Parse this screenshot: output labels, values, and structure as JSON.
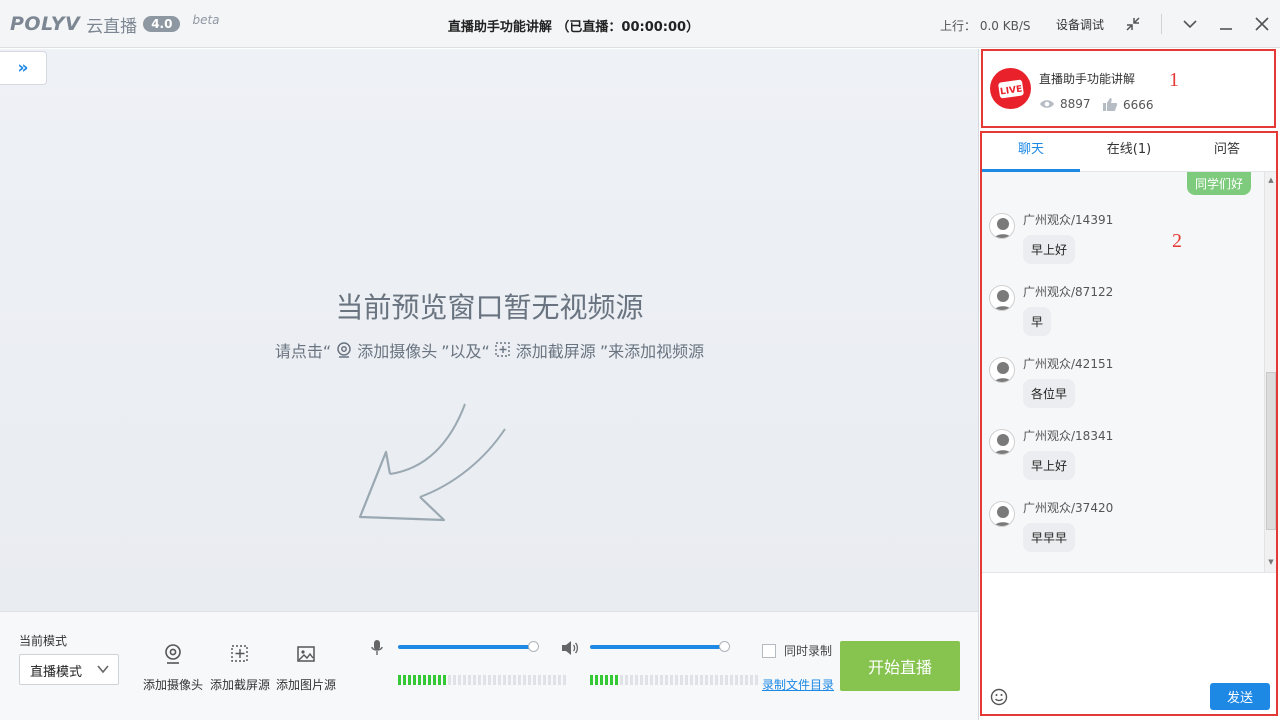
{
  "app": {
    "logo_brand": "POLYV",
    "logo_cn": "云直播",
    "version": "4.0",
    "beta": "beta",
    "window_title": "直播助手功能讲解 （已直播：00:00:00）",
    "upload_speed": "上行： 0.0 KB/S",
    "device_test": "设备调试"
  },
  "preview": {
    "empty_title": "当前预览窗口暂无视频源",
    "hint_prefix": "请点击“",
    "hint_camera": "添加摄像头",
    "hint_middle": "”以及“",
    "hint_screen": "添加截屏源",
    "hint_suffix": "”来添加视频源"
  },
  "controls": {
    "mode_label": "当前模式",
    "mode_value": "直播模式",
    "add_camera": "添加摄像头",
    "add_screen": "添加截屏源",
    "add_image": "添加图片源",
    "mic_level": 1.0,
    "speaker_level": 1.0,
    "mic_meter_on": 10,
    "speaker_meter_on": 6,
    "meter_total": 34,
    "record_label": "同时录制",
    "record_dir": "录制文件目录",
    "start_button": "开始直播"
  },
  "room": {
    "title": "直播助手功能讲解",
    "views": "8897",
    "likes": "6666",
    "callout_1": "1",
    "callout_2": "2"
  },
  "chat": {
    "tabs": [
      {
        "label": "聊天",
        "active": true
      },
      {
        "label": "在线(1)",
        "active": false
      },
      {
        "label": "问答",
        "active": false
      }
    ],
    "self_message": "同学们好",
    "messages": [
      {
        "name": "广州观众/14391",
        "text": "早上好"
      },
      {
        "name": "广州观众/87122",
        "text": "早"
      },
      {
        "name": "广州观众/42151",
        "text": "各位早"
      },
      {
        "name": "广州观众/18341",
        "text": "早上好"
      },
      {
        "name": "广州观众/37420",
        "text": "早早早"
      }
    ],
    "send_button": "发送"
  },
  "colors": {
    "accent": "#1e88e5",
    "start_button": "#86c44f",
    "annotation": "#e53935",
    "meter_on": "#35c935"
  }
}
